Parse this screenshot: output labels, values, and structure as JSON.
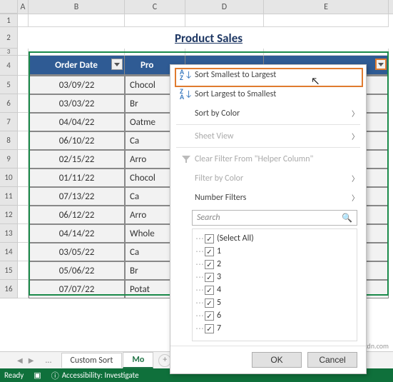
{
  "columns": {
    "a": "A",
    "b": "B",
    "c": "C",
    "d": "D",
    "e": "E"
  },
  "title": "Product Sales",
  "headers": {
    "order_date": "Order Date",
    "product": "Pro"
  },
  "rows": [
    {
      "n": "5",
      "date": "03/09/22",
      "prod": "Chocol"
    },
    {
      "n": "6",
      "date": "03/03/22",
      "prod": "Br"
    },
    {
      "n": "7",
      "date": "04/04/22",
      "prod": "Oatme"
    },
    {
      "n": "8",
      "date": "06/10/22",
      "prod": "Ca"
    },
    {
      "n": "9",
      "date": "02/15/22",
      "prod": "Arro"
    },
    {
      "n": "10",
      "date": "01/11/22",
      "prod": "Chocol"
    },
    {
      "n": "11",
      "date": "07/13/22",
      "prod": "Ca"
    },
    {
      "n": "12",
      "date": "06/12/22",
      "prod": "Arro"
    },
    {
      "n": "13",
      "date": "04/14/22",
      "prod": "Whole"
    },
    {
      "n": "14",
      "date": "03/05/22",
      "prod": "Ca"
    },
    {
      "n": "15",
      "date": "05/06/22",
      "prod": "Br"
    },
    {
      "n": "16",
      "date": "07/07/22",
      "prod": "Potat"
    }
  ],
  "row1": "1",
  "row2": "2",
  "row3": "3",
  "row4": "4",
  "filter_menu": {
    "sort_asc": "Sort Smallest to Largest",
    "sort_desc": "Sort Largest to Smallest",
    "sort_color": "Sort by Color",
    "sheet_view": "Sheet View",
    "clear_filter": "Clear Filter From \"Helper Column\"",
    "filter_color": "Filter by Color",
    "number_filters": "Number Filters",
    "search_placeholder": "Search",
    "select_all": "(Select All)",
    "options": [
      "1",
      "2",
      "3",
      "4",
      "5",
      "6",
      "7"
    ],
    "ok": "OK",
    "cancel": "Cancel",
    "az": "A\nZ",
    "za": "Z\nA"
  },
  "tabs": {
    "dots": "...",
    "custom": "Custom Sort",
    "active": "Mo",
    "add": "+"
  },
  "status": {
    "ready": "Ready",
    "accessibility": "Accessibility: Investigate"
  },
  "watermark": "wsxdn.com"
}
